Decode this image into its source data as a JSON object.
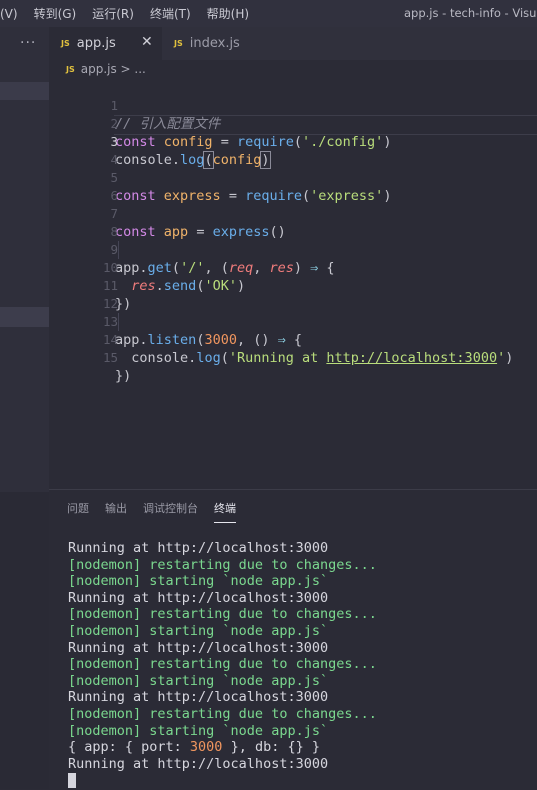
{
  "menu": [
    "(V)",
    "转到(G)",
    "运行(R)",
    "终端(T)",
    "帮助(H)"
  ],
  "window_title": "app.js - tech-info - Visual S",
  "sidebar": {
    "more": "···"
  },
  "tabs": [
    {
      "icon": "JS",
      "label": "app.js",
      "close": "✕"
    },
    {
      "icon": "JS",
      "label": "index.js"
    }
  ],
  "breadcrumb": {
    "icon": "JS",
    "text": "app.js > ..."
  },
  "line_numbers": [
    "1",
    "2",
    "3",
    "4",
    "5",
    "6",
    "7",
    "8",
    "9",
    "10",
    "11",
    "12",
    "13",
    "14",
    "15"
  ],
  "code": {
    "l1": "// 引入配置文件",
    "l2": {
      "kw": "const",
      "var": "config",
      "eq": "=",
      "fn": "require",
      "p1": "(",
      "str": "'./config'",
      "p2": ")"
    },
    "l3": {
      "obj": "console",
      "dot": ".",
      "fn": "log",
      "p1": "(",
      "arg": "config",
      "p2": ")"
    },
    "l5": {
      "kw": "const",
      "var": "express",
      "eq": "=",
      "fn": "require",
      "p1": "(",
      "str": "'express'",
      "p2": ")"
    },
    "l7": {
      "kw": "const",
      "var": "app",
      "eq": "=",
      "fn": "express",
      "p": "()"
    },
    "l9": {
      "obj": "app",
      "dot": ".",
      "fn": "get",
      "p1": "(",
      "str": "'/'",
      "c1": ", (",
      "a1": "req",
      "c2": ", ",
      "a2": "res",
      "c3": ") ",
      "arrow": "⇒",
      "brace": " {"
    },
    "l10": {
      "obj": "res",
      "dot": ".",
      "fn": "send",
      "p1": "(",
      "str": "'OK'",
      "p2": ")"
    },
    "l11": "})",
    "l13": {
      "obj": "app",
      "dot": ".",
      "fn": "listen",
      "p1": "(",
      "num": "3000",
      "c1": ", () ",
      "arrow": "⇒",
      "brace": " {"
    },
    "l14": {
      "obj": "console",
      "dot": ".",
      "fn": "log",
      "p1": "(",
      "s1": "'Running at ",
      "url": "http://localhost:3000",
      "s2": "'",
      "p2": ")"
    },
    "l15": "})"
  },
  "panel_tabs": [
    "问题",
    "输出",
    "调试控制台",
    "终端"
  ],
  "terminal": {
    "running": "Running at http://localhost:3000",
    "restarting": "[nodemon] restarting due to changes...",
    "starting": "[nodemon] starting `node app.js`",
    "obj_a": "{ app: { port: ",
    "port": "3000",
    "obj_b": " }, db: {} }"
  }
}
